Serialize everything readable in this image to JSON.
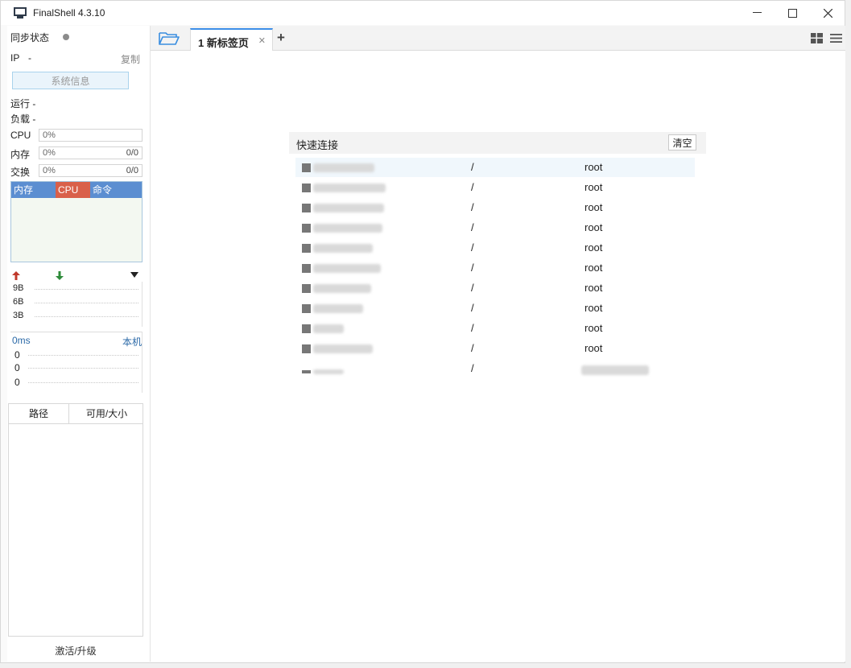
{
  "app": {
    "title": "FinalShell 4.3.10"
  },
  "window_controls": {
    "minimize": "—",
    "maximize": "☐",
    "close": "✕"
  },
  "sidebar": {
    "sync_label": "同步状态",
    "ip_label": "IP",
    "ip_value": "-",
    "copy_label": "复制",
    "sysinfo_label": "系统信息",
    "run_label": "运行 -",
    "load_label": "负载 -",
    "cpu": {
      "label": "CPU",
      "pct": "0%"
    },
    "mem": {
      "label": "内存",
      "pct": "0%",
      "ratio": "0/0"
    },
    "swap": {
      "label": "交换",
      "pct": "0%",
      "ratio": "0/0"
    },
    "proc_tabs": [
      "内存",
      "CPU",
      "命令"
    ],
    "net_labels": [
      "9B",
      "6B",
      "3B"
    ],
    "ping": {
      "value": "0ms",
      "local": "本机",
      "labels": [
        "0",
        "0",
        "0"
      ]
    },
    "disk_cols": [
      "路径",
      "可用/大小"
    ],
    "activate_label": "激活/升级"
  },
  "tabs": {
    "active_label": "1 新标签页",
    "close": "✕",
    "add": "+"
  },
  "quick_connect": {
    "title": "快速连接",
    "clear_label": "清空",
    "rows": [
      {
        "path": "/",
        "user": "root"
      },
      {
        "path": "/",
        "user": "root"
      },
      {
        "path": "/",
        "user": "root"
      },
      {
        "path": "/",
        "user": "root"
      },
      {
        "path": "/",
        "user": "root"
      },
      {
        "path": "/",
        "user": "root"
      },
      {
        "path": "/",
        "user": "root"
      },
      {
        "path": "/",
        "user": "root"
      },
      {
        "path": "/",
        "user": "root"
      },
      {
        "path": "/",
        "user": "root"
      },
      {
        "path": "/",
        "user": ""
      }
    ]
  },
  "colors": {
    "accent": "#3c8ee8",
    "proc_header": "#5b8ed1",
    "cpu_tab": "#d9604a",
    "upload": "#c0392b",
    "download": "#2e8b3a"
  }
}
